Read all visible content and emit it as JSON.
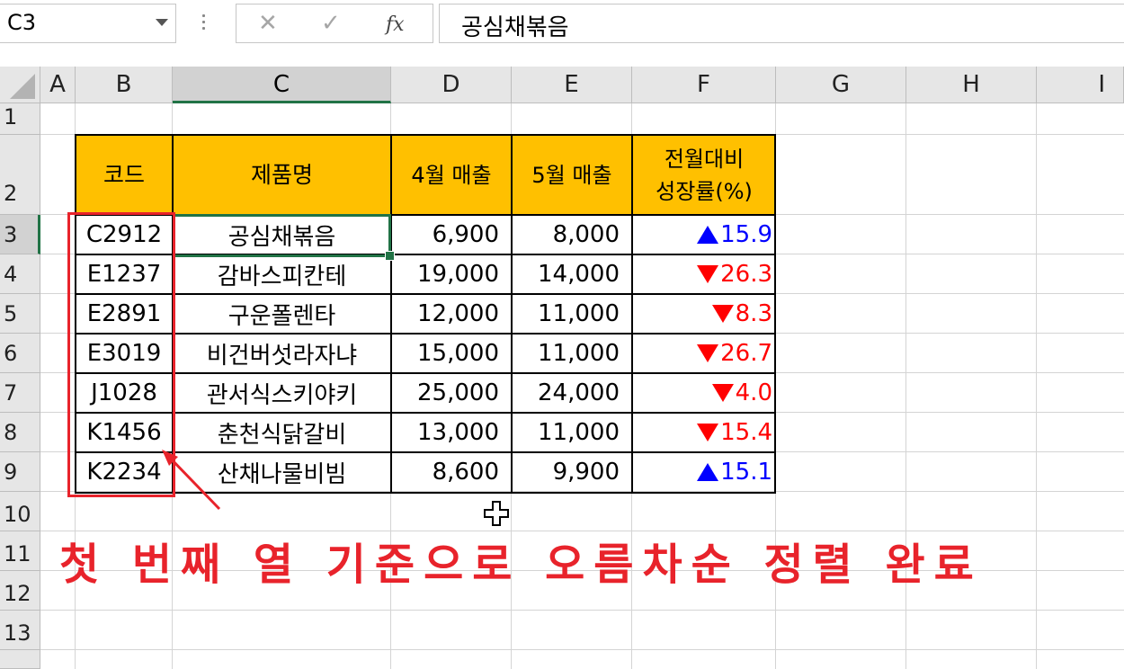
{
  "formula_bar": {
    "name_box": "C3",
    "cancel_glyph": "✕",
    "enter_glyph": "✓",
    "fx_label": "fx",
    "formula": "공심채볶음"
  },
  "columns": [
    "A",
    "B",
    "C",
    "D",
    "E",
    "F",
    "G",
    "H",
    "I"
  ],
  "rows": [
    "1",
    "2",
    "3",
    "4",
    "5",
    "6",
    "7",
    "8",
    "9",
    "10",
    "11",
    "12",
    "13"
  ],
  "table": {
    "headers": {
      "code": "코드",
      "name": "제품명",
      "april": "4월 매출",
      "may": "5월 매출",
      "rate_line1": "전월대비",
      "rate_line2": "성장률(%)"
    },
    "records": [
      {
        "code": "C2912",
        "name": "공심채볶음",
        "april": "6,900",
        "may": "8,000",
        "rate": "15.9",
        "dir": "up"
      },
      {
        "code": "E1237",
        "name": "감바스피칸테",
        "april": "19,000",
        "may": "14,000",
        "rate": "26.3",
        "dir": "down"
      },
      {
        "code": "E2891",
        "name": "구운폴렌타",
        "april": "12,000",
        "may": "11,000",
        "rate": "8.3",
        "dir": "down"
      },
      {
        "code": "E3019",
        "name": "비건버섯라자냐",
        "april": "15,000",
        "may": "11,000",
        "rate": "26.7",
        "dir": "down"
      },
      {
        "code": "J1028",
        "name": "관서식스키야키",
        "april": "25,000",
        "may": "24,000",
        "rate": "4.0",
        "dir": "down"
      },
      {
        "code": "K1456",
        "name": "춘천식닭갈비",
        "april": "13,000",
        "may": "11,000",
        "rate": "15.4",
        "dir": "down"
      },
      {
        "code": "K2234",
        "name": "산채나물비빔",
        "april": "8,600",
        "may": "9,900",
        "rate": "15.1",
        "dir": "up"
      }
    ]
  },
  "colors": {
    "header_fill": "#ffc000",
    "selection": "#217346",
    "annotation": "#e8232b",
    "up": "#0000ff",
    "down": "#ff0000"
  },
  "annotation": "첫 번째 열 기준으로 오름차순 정렬 완료"
}
